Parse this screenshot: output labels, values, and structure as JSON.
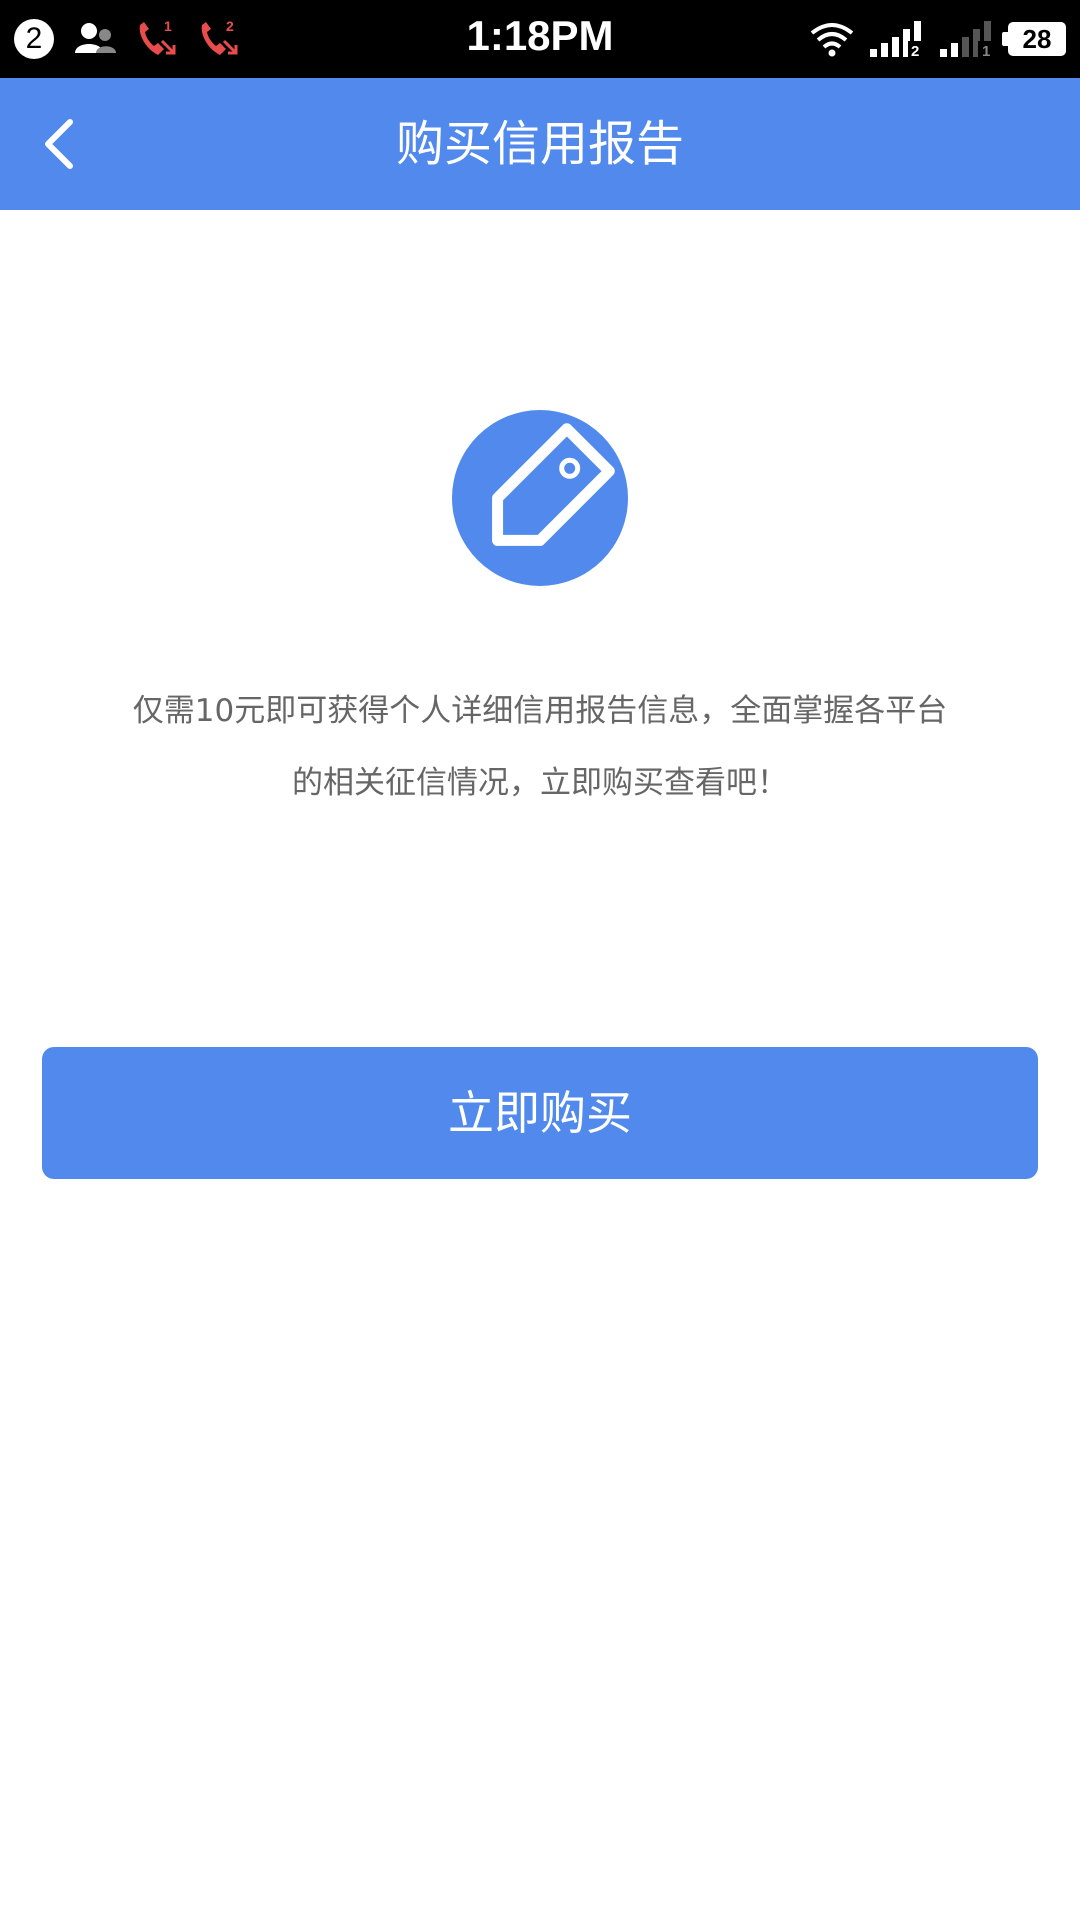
{
  "status_bar": {
    "notification_count": "2",
    "time": "1:18PM",
    "battery": "28",
    "missed_call_sim1": "1",
    "missed_call_sim2": "2",
    "signal_sim1": "2",
    "signal_sim2": "1",
    "icons": [
      "contacts-icon",
      "missed-call-icon",
      "missed-call-icon",
      "wifi-icon",
      "signal-icon",
      "signal-icon",
      "battery-icon"
    ]
  },
  "header": {
    "title": "购买信用报告",
    "back_icon": "chevron-left-icon"
  },
  "main": {
    "icon": "price-tag-icon",
    "description": "仅需10元即可获得个人详细信用报告信息，全面掌握各平台的相关征信情况，立即购买查看吧！",
    "buy_button_label": "立即购买"
  },
  "colors": {
    "accent": "#518aec",
    "text_secondary": "#666666",
    "missed_call": "#e84c4c"
  }
}
